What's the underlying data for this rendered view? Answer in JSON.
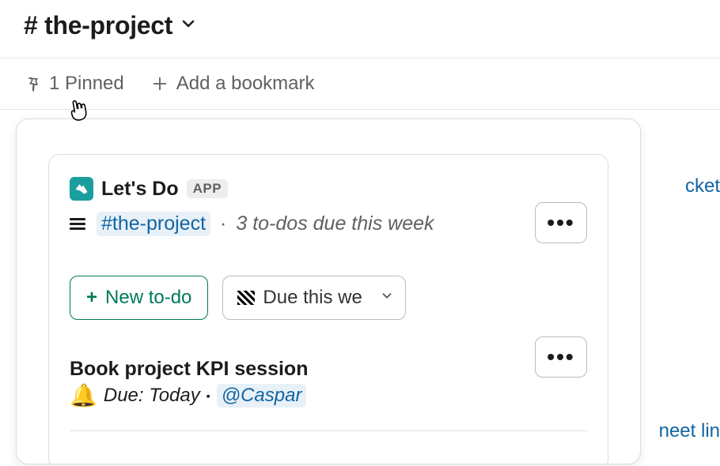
{
  "header": {
    "channel_name": "# the-project"
  },
  "toolbar": {
    "pinned_label": "1 Pinned",
    "bookmark_label": "Add a bookmark"
  },
  "background": {
    "link1": "cket",
    "link2": "neet lin"
  },
  "pinned_card": {
    "app_name": "Let's Do",
    "app_badge": "APP",
    "channel_link": "#the-project",
    "summary": "3 to-dos due this week",
    "new_todo_label": "New to-do",
    "filter_label": "Due this we",
    "todo": {
      "title": "Book project KPI session",
      "due_label": "Due: Today",
      "assignee": "@Caspar"
    },
    "more_label": "•••"
  }
}
